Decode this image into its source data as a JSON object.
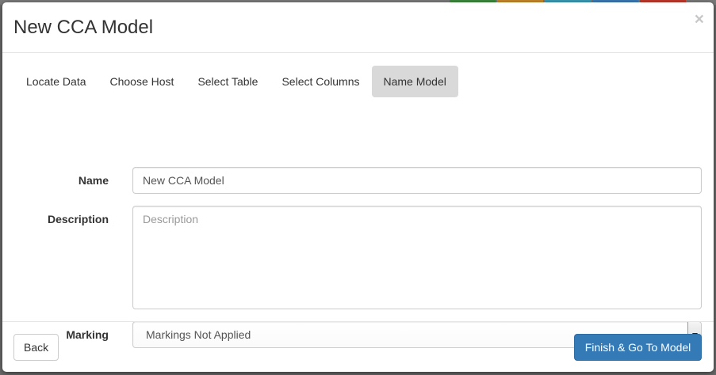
{
  "modal": {
    "title": "New CCA Model",
    "close_symbol": "×"
  },
  "tabs": [
    {
      "label": "Locate Data",
      "active": false
    },
    {
      "label": "Choose Host",
      "active": false
    },
    {
      "label": "Select Table",
      "active": false
    },
    {
      "label": "Select Columns",
      "active": false
    },
    {
      "label": "Name Model",
      "active": true
    }
  ],
  "form": {
    "name": {
      "label": "Name",
      "value": "New CCA Model"
    },
    "description": {
      "label": "Description",
      "value": "",
      "placeholder": "Description"
    },
    "marking": {
      "label": "Marking",
      "selected": "Markings Not Applied"
    }
  },
  "footer": {
    "back_label": "Back",
    "finish_label": "Finish & Go To Model"
  },
  "colors": {
    "primary": "#337ab7",
    "active_tab": "#d9d9d9",
    "backdrop_badges": [
      "#3c8a3c",
      "#c7882a",
      "#3a9bb5",
      "#3c7ab5",
      "#c0392b"
    ]
  }
}
